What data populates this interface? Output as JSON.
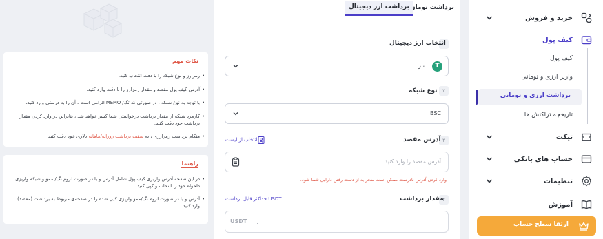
{
  "sidebar": {
    "items": [
      {
        "label": "خرید و فروش",
        "icon": "trade-icon"
      },
      {
        "label": "کیف پول",
        "icon": "wallet-icon"
      },
      {
        "label": "تیکت",
        "icon": "ticket-icon"
      },
      {
        "label": "حساب های بانکی",
        "icon": "bank-icon"
      },
      {
        "label": "تنظیمات",
        "icon": "gear-icon"
      },
      {
        "label": "آموزش",
        "icon": "book-icon"
      }
    ],
    "wallet_sub": [
      "کیف پول",
      "واریز ارزی و تومانی",
      "برداشت ارزی و تومانی",
      "تاریخچه تراکنش ها"
    ],
    "upgrade_label": "ارتقا سطح حساب"
  },
  "tabs": {
    "toman": "برداشت تومان",
    "crypto": "برداشت ارز دیجیتال"
  },
  "form": {
    "step1": {
      "num": "۱",
      "title": "انتخاب ارز دیجیتال",
      "value": "تتر"
    },
    "step2": {
      "num": "۲",
      "title": "نوع شبکه",
      "value": "BSC"
    },
    "step3": {
      "num": "۳",
      "title": "آدرس مقصد",
      "select_from_list": "انتخاب از لیست",
      "placeholder": "آدرس مقصد را وارد کنید",
      "warning": "وارد کردن آدرس نادرست ممکن است منجر به از دست رفتن دارایی شما شود."
    },
    "step4": {
      "num": "۴",
      "title": "مقدار برداشت",
      "max_link": "حداکثر قابل برداشت USDT",
      "placeholder": "۰.۰۰",
      "currency": "USDT"
    }
  },
  "notes": {
    "title": "نکات مهم",
    "items": [
      "رمزارز و نوع شبکه را با دقت انتخاب کنید.",
      "آدرس کیف پول مقصد و مقدار رمزارز را با دقت وارد کنید.",
      "با توجه به نوع شبکه ، در صورتی که تگ/ MEMO الزامی است ، آن را به درستی وارد کنید.",
      "کارمزد شبکه از مقدار برداشت درخواستی شما کسر خواهد شد ، بنابراین در وارد کردن مقدار برداشت خود دقت کنید.",
      "دلاری خود دقت کنید"
    ],
    "item5_prefix": "هنگام برداشت رمزارزی ، به",
    "item5_red": "سقف برداشت روزانه/ماهانه"
  },
  "guide": {
    "title": "راهنما",
    "items": [
      "در این صفحه آدرس واریزی کیف پول شامل آدرس و یا در صورت لزوم تگ/ ممو و شبکه واریزی دلخواه خود را انتخاب و کپی کنید.",
      "آدرس و یا در صورت لزوم تگ/ممو واریزی کپی شده را در صفحه‌ی مربوط به برداشت (مقصد) وارد کنید."
    ]
  },
  "colors": {
    "accent": "#4b3ec8",
    "warning": "#e05a4a",
    "upgrade": "#f5a93a",
    "tether": "#26a17b"
  }
}
